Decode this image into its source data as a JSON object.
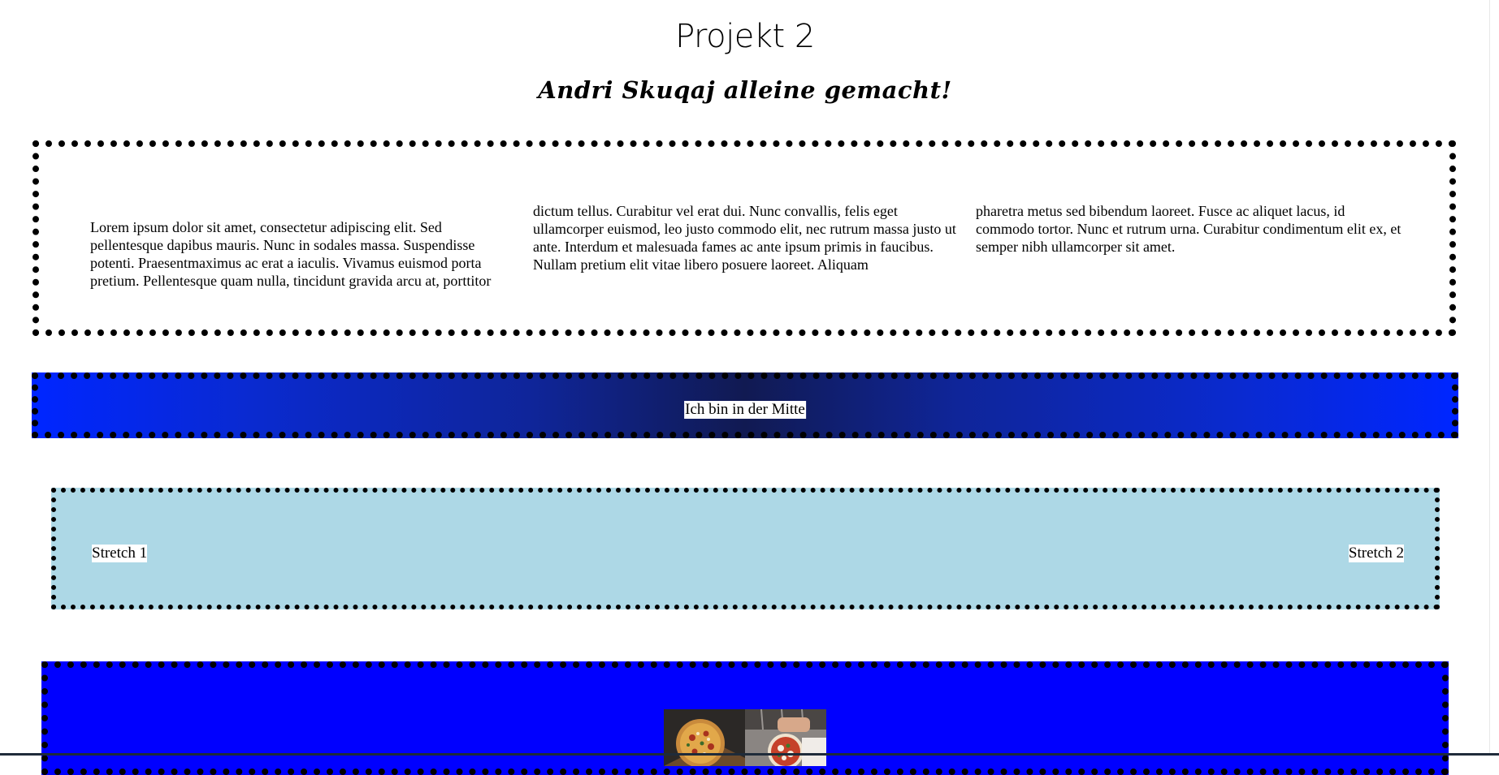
{
  "header": {
    "title": "Projekt 2",
    "subtitle": "Andri Skuqaj alleine gemacht!"
  },
  "text_box": {
    "columns": [
      "Lorem ipsum dolor sit amet, consectetur adipiscing elit. Sed pellentesque dapibus mauris. Nunc in sodales massa. Suspendisse potenti. Praesentmaximus ac erat a iaculis. Vivamus euismod porta pretium. Pellentesque quam nulla, tincidunt gravida arcu at, porttitor",
      "dictum tellus. Curabitur vel erat dui. Nunc convallis, felis eget ullamcorper euismod, leo justo commodo elit, nec rutrum massa justo ut ante. Interdum et malesuada fames ac ante ipsum primis in faucibus. Nullam pretium elit vitae libero posuere laoreet. Aliquam",
      "pharetra metus sed bibendum laoreet. Fusce ac aliquet lacus, id commodo tortor. Nunc et rutrum urna. Curabitur condimentum elit ex, et semper nibh ullamcorper sit amet."
    ]
  },
  "center_box": {
    "label": "Ich bin in der Mitte"
  },
  "stretch_box": {
    "item_1": "Stretch 1",
    "item_2": "Stretch 2",
    "background": "#add8e6"
  },
  "image_box": {
    "background": "#0000ff",
    "images": [
      "pizza-photo-1",
      "pizza-photo-2"
    ]
  },
  "colors": {
    "gradient_edge": "#0026ff",
    "gradient_center": "#111a52"
  }
}
